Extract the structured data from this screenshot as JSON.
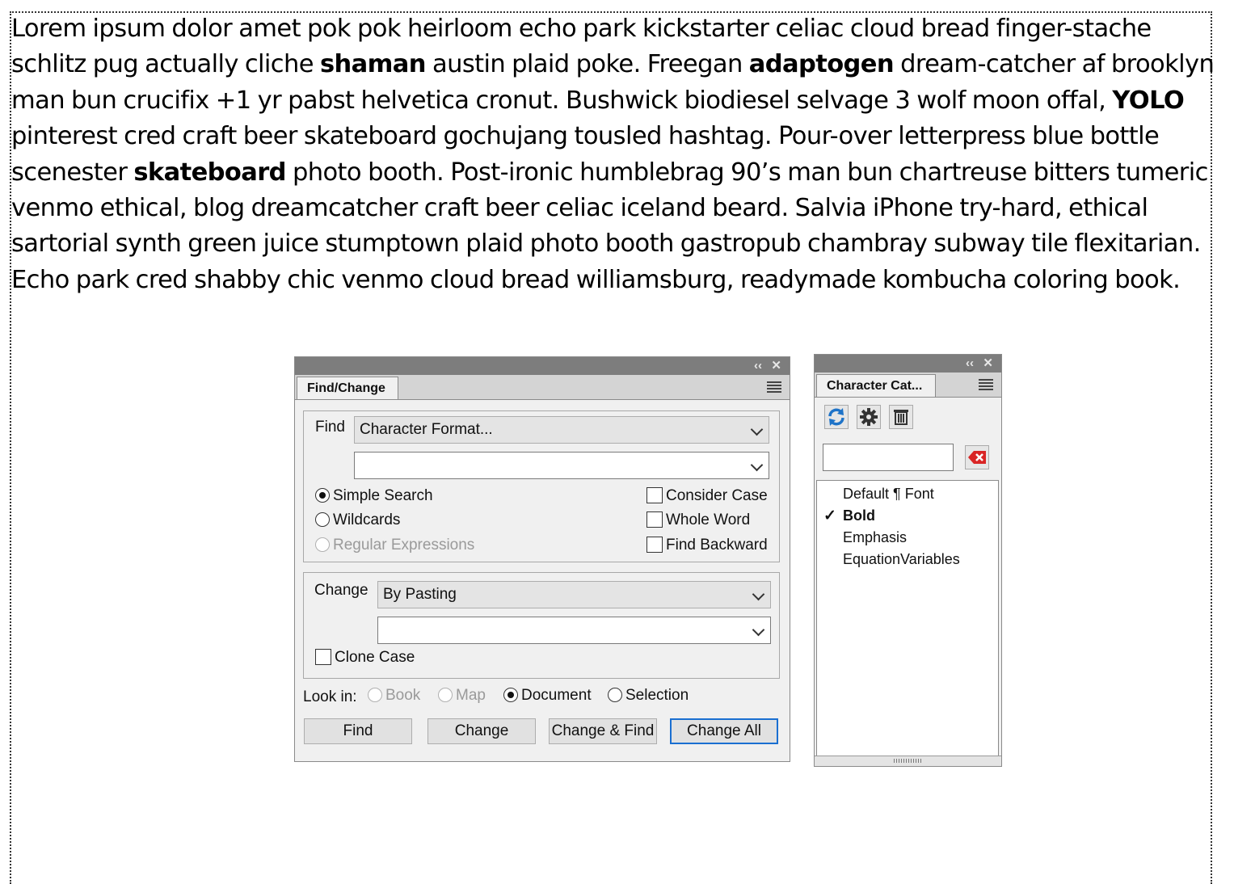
{
  "document": {
    "paragraph": [
      {
        "text": "Lorem ipsum dolor amet pok pok heirloom echo park kickstarter celiac cloud bread finger-stache schlitz pug actually cliche ",
        "bold": false
      },
      {
        "text": "shaman",
        "bold": true
      },
      {
        "text": " austin plaid poke. Freegan ",
        "bold": false
      },
      {
        "text": "adaptogen",
        "bold": true
      },
      {
        "text": " dream-catcher af brooklyn man bun crucifix +1 yr pabst helvetica cronut. Bushwick biodiesel selvage 3 wolf moon offal, ",
        "bold": false
      },
      {
        "text": "YOLO",
        "bold": true
      },
      {
        "text": " pinterest cred craft beer skateboard gochujang tousled hashtag. Pour-over letterpress blue bottle scenester ",
        "bold": false
      },
      {
        "text": "skateboard",
        "bold": true
      },
      {
        "text": " photo booth. Post-ironic humblebrag 90’s man bun chartreuse bitters tumeric venmo ethical, blog dreamcatcher craft beer celiac iceland beard. Salvia iPhone try-hard, ethical sartorial synth green juice stumptown plaid photo booth gastropub chambray subway tile flexitarian. Echo park cred shabby chic venmo cloud bread williamsburg, readymade kombucha coloring book.",
        "bold": false
      }
    ]
  },
  "find_change": {
    "tab_label": "Find/Change",
    "find": {
      "label": "Find",
      "type_value": "Character Format...",
      "text_value": ""
    },
    "search_modes": [
      {
        "label": "Simple Search",
        "selected": true,
        "enabled": true
      },
      {
        "label": "Wildcards",
        "selected": false,
        "enabled": true
      },
      {
        "label": "Regular Expressions",
        "selected": false,
        "enabled": false
      }
    ],
    "options": [
      {
        "label": "Consider Case",
        "checked": false
      },
      {
        "label": "Whole Word",
        "checked": false
      },
      {
        "label": "Find Backward",
        "checked": false
      }
    ],
    "change": {
      "label": "Change",
      "type_value": "By Pasting",
      "text_value": "",
      "clone_case_label": "Clone Case"
    },
    "look_in": {
      "label": "Look in:",
      "options": [
        {
          "label": "Book",
          "selected": false,
          "enabled": false
        },
        {
          "label": "Map",
          "selected": false,
          "enabled": false
        },
        {
          "label": "Document",
          "selected": true,
          "enabled": true
        },
        {
          "label": "Selection",
          "selected": false,
          "enabled": true
        }
      ]
    },
    "buttons": {
      "find": "Find",
      "change": "Change",
      "change_and_find": "Change & Find",
      "change_all": "Change All"
    }
  },
  "character_catalog": {
    "tab_label": "Character Cat...",
    "search_value": "",
    "items": [
      {
        "label": "Default ¶ Font",
        "selected": false
      },
      {
        "label": "Bold",
        "selected": true
      },
      {
        "label": "Emphasis",
        "selected": false
      },
      {
        "label": "EquationVariables",
        "selected": false
      }
    ],
    "selected_mark": "✓"
  },
  "titlebar": {
    "collapse_glyph": "‹‹",
    "close_glyph": "✕"
  },
  "colors": {
    "accent": "#1a6fd1",
    "clear_red": "#d92525",
    "refresh_blue": "#1e73c8"
  }
}
